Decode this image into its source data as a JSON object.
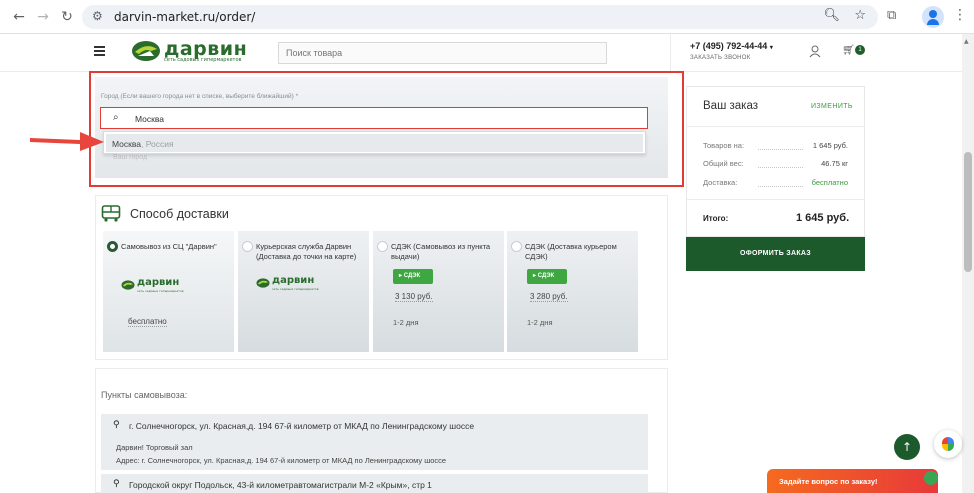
{
  "browser": {
    "url": "darvin-market.ru/order/",
    "icons": [
      "back-icon",
      "forward-icon",
      "reload-icon",
      "site-settings-icon",
      "zoom-icon",
      "bookmark-star-icon",
      "extensions-icon",
      "profile-icon",
      "menu-icon"
    ]
  },
  "header": {
    "logo_text": "дарвин",
    "logo_sub": "сеть садовых гипермаркетов",
    "search_placeholder": "Поиск товара",
    "phone": "+7 (495) 792-44-44",
    "callback": "ЗАКАЗАТЬ ЗВОНОК",
    "cart_count": "1"
  },
  "city": {
    "label": "Город (Если вашего города нет в списке, выберите ближайший) *",
    "value": "Москва",
    "suggestion_city": "Москва",
    "suggestion_country": ", Россия",
    "hint_below": "Ваш город"
  },
  "delivery": {
    "title": "Способ доставки",
    "options": [
      {
        "title": "Самовывоз из СЦ \"Дарвин\"",
        "price": "бесплатно",
        "selected": true,
        "logo_text": "дарвин",
        "logo_sub": "сеть садовых гипермаркетов"
      },
      {
        "title": "Курьерская служба Дарвин (Доставка до точки на карте)",
        "selected": false,
        "logo_text": "дарвин",
        "logo_sub": "сеть садовых гипермаркетов"
      },
      {
        "title": "СДЭК (Самовывоз из пункта выдачи)",
        "badge": "СДЭК",
        "price": "3 130 руб.",
        "term": "1-2 дня",
        "selected": false
      },
      {
        "title": "СДЭК (Доставка курьером СДЭК)",
        "badge": "СДЭК",
        "price": "3 280 руб.",
        "term": "1-2 дня",
        "selected": false
      }
    ]
  },
  "pickup": {
    "title": "Пункты самовывоза:",
    "points": [
      {
        "address": "г. Солнечногорск, ул. Красная,д. 194 67-й километр от МКАД по Ленинградскому шоссе",
        "name": "Дарвин! Торговый зал",
        "full_address": "Адрес: г. Солнечногорск, ул. Красная,д. 194 67-й километр от МКАД по Ленинградскому шоссе"
      },
      {
        "address": "Городской округ Подольск, 43-й километравтомагистрали М-2 «Крым», стр 1"
      }
    ]
  },
  "order": {
    "title": "Ваш заказ",
    "change": "ИЗМЕНИТЬ",
    "rows": [
      {
        "label": "Товаров на:",
        "value": "1 645 руб."
      },
      {
        "label": "Общий вес:",
        "value": "46.75 кг"
      },
      {
        "label": "Доставка:",
        "value": "бесплатно"
      }
    ],
    "total_label": "Итого:",
    "total_value": "1 645 руб.",
    "checkout": "ОФОРМИТЬ ЗАКАЗ"
  },
  "floating": {
    "chat": "Задайте вопрос по заказу!",
    "up": "↑"
  },
  "colors": {
    "brand_green": "#1d5a2b",
    "accent_green": "#3c9a3f",
    "highlight_red": "#e13b33",
    "sdek_green": "#3ea742"
  }
}
